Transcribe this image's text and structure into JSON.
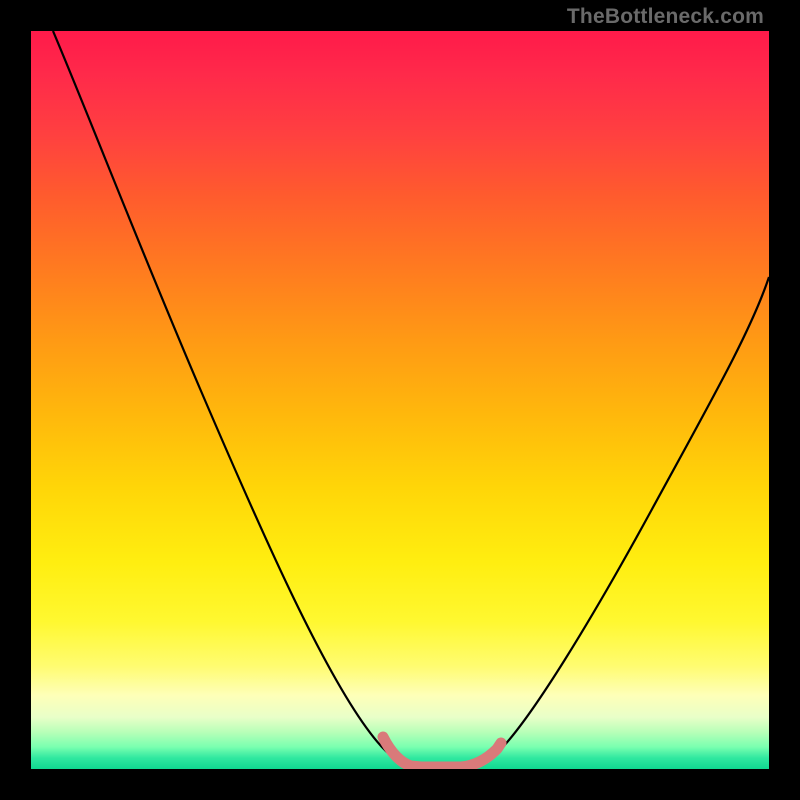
{
  "watermark": "TheBottleneck.com",
  "chart_data": {
    "type": "line",
    "title": "",
    "xlabel": "",
    "ylabel": "",
    "xlim": [
      0,
      100
    ],
    "ylim": [
      0,
      100
    ],
    "series": [
      {
        "name": "curve",
        "color": "#000000",
        "stroke_width": 2,
        "x": [
          3,
          10,
          20,
          30,
          38,
          45,
          48,
          50,
          53,
          57,
          60,
          63,
          66,
          72,
          80,
          88,
          94,
          100
        ],
        "y": [
          100,
          85,
          64,
          44,
          28,
          13,
          5,
          1,
          0,
          0,
          0,
          1,
          4,
          14,
          29,
          45,
          56,
          67
        ]
      },
      {
        "name": "bottom-marker",
        "color": "#d97a7a",
        "stroke_width": 9,
        "x": [
          48,
          50,
          53,
          57,
          60,
          63
        ],
        "y": [
          5,
          1,
          0,
          0,
          0,
          1
        ]
      }
    ],
    "gradient_stops": [
      {
        "pos": 0,
        "color": "#ff1a4a"
      },
      {
        "pos": 0.5,
        "color": "#ffd000"
      },
      {
        "pos": 0.88,
        "color": "#fffc80"
      },
      {
        "pos": 1.0,
        "color": "#10d890"
      }
    ]
  }
}
